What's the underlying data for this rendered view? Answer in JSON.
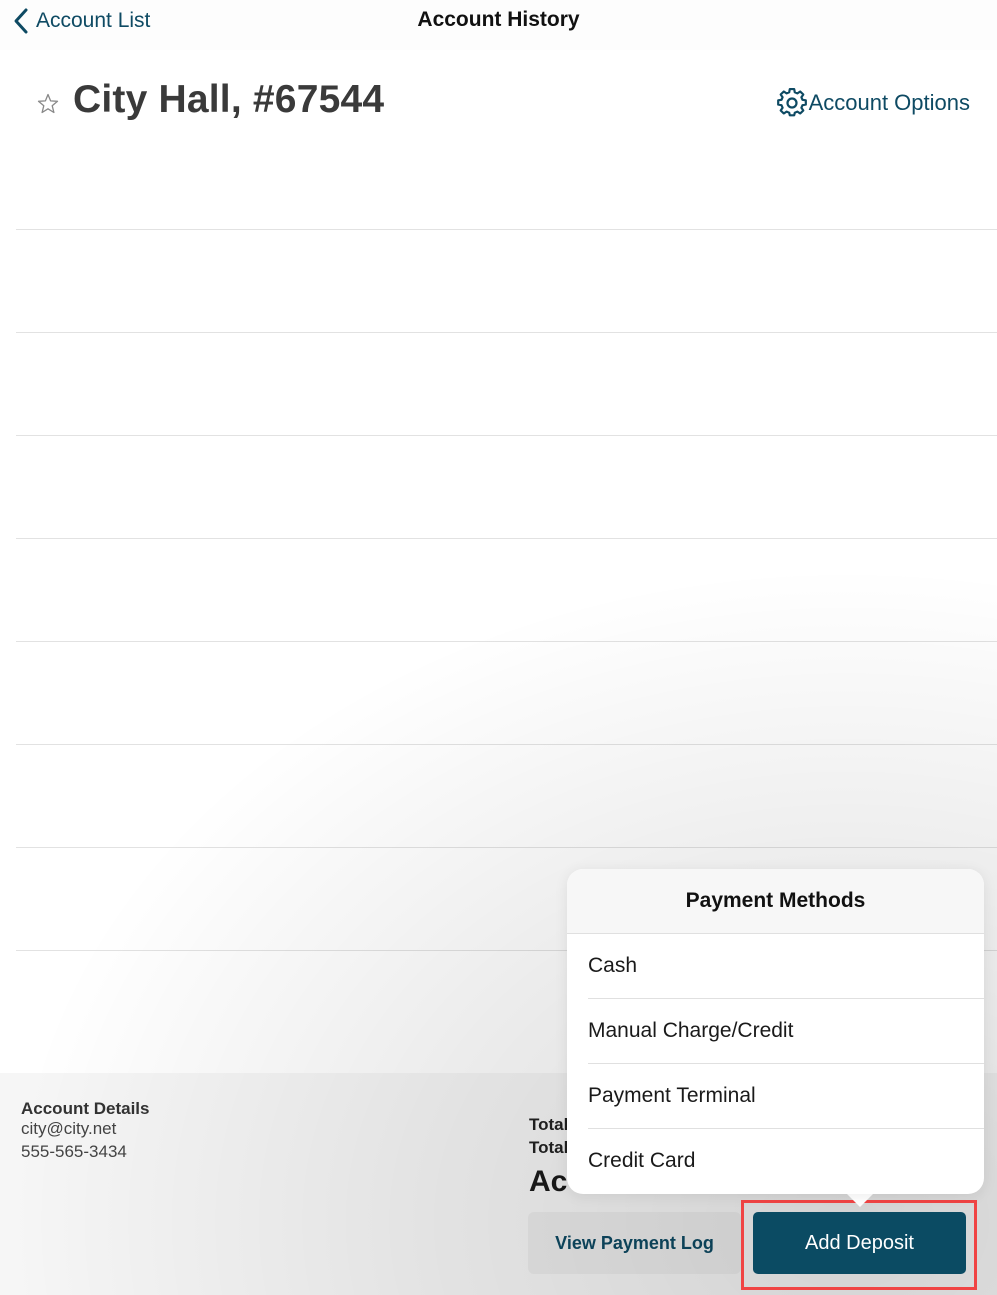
{
  "nav": {
    "back_label": "Account List",
    "title": "Account History"
  },
  "account": {
    "title": "City Hall, #67544",
    "favorite": false,
    "options_label": "Account Options"
  },
  "history_rows": [
    {},
    {},
    {},
    {},
    {},
    {},
    {},
    {}
  ],
  "footer": {
    "details_label": "Account Details",
    "email": "city@city.net",
    "phone": "555-565-3434",
    "total_1_partial": "Total",
    "total_2_partial": "Total",
    "account_partial": "Ac",
    "view_payment_log_label": "View Payment Log",
    "add_deposit_label": "Add Deposit"
  },
  "payment_methods": {
    "title": "Payment Methods",
    "items": [
      {
        "label": "Cash"
      },
      {
        "label": "Manual Charge/Credit"
      },
      {
        "label": "Payment Terminal"
      },
      {
        "label": "Credit Card"
      }
    ]
  },
  "colors": {
    "accent": "#0e4a63",
    "primary_button": "#0b4b63",
    "highlight": "#f04444"
  }
}
